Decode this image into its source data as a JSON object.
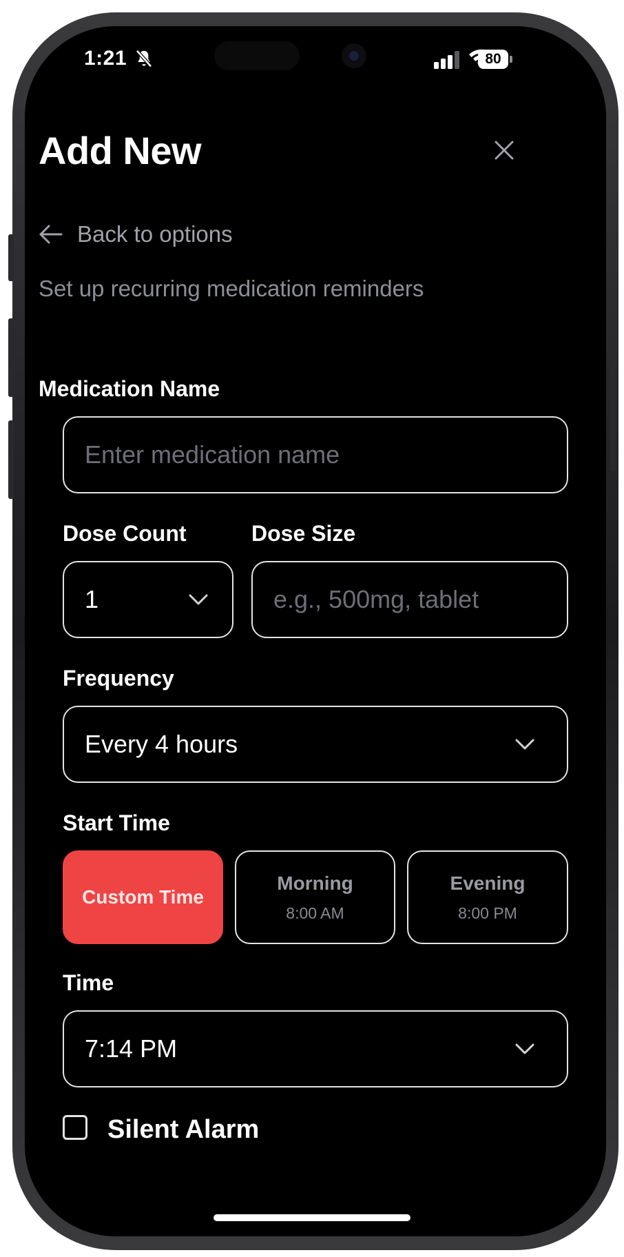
{
  "status_bar": {
    "time": "1:21",
    "battery": "80"
  },
  "header": {
    "title": "Add New",
    "back_label": "Back to options",
    "subtitle": "Set up recurring medication reminders"
  },
  "form": {
    "medication_name": {
      "label": "Medication Name",
      "placeholder": "Enter medication name",
      "value": ""
    },
    "dose_count": {
      "label": "Dose Count",
      "value": "1"
    },
    "dose_size": {
      "label": "Dose Size",
      "placeholder": "e.g., 500mg, tablet",
      "value": ""
    },
    "frequency": {
      "label": "Frequency",
      "value": "Every 4 hours"
    },
    "start_time": {
      "label": "Start Time",
      "options": [
        {
          "name": "Custom Time",
          "time": "",
          "selected": true
        },
        {
          "name": "Morning",
          "time": "8:00 AM",
          "selected": false
        },
        {
          "name": "Evening",
          "time": "8:00 PM",
          "selected": false
        }
      ]
    },
    "time": {
      "label": "Time",
      "value": "7:14 PM"
    },
    "silent_alarm": {
      "label": "Silent Alarm",
      "checked": false
    }
  },
  "colors": {
    "accent": "#ef4444",
    "background": "#000000",
    "border": "#e4e4e7",
    "muted_text": "#a1a1aa"
  },
  "icons": [
    "bell-slash-icon",
    "signal-icon",
    "wifi-icon",
    "battery-icon",
    "close-icon",
    "arrow-left-icon",
    "chevron-down-icon"
  ]
}
